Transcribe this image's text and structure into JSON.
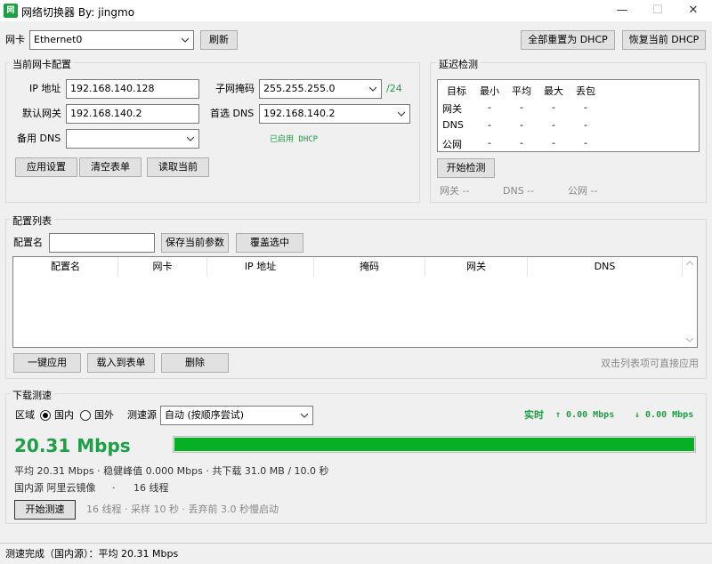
{
  "window": {
    "title": "网络切换器  By: jingmo",
    "minimize": "—",
    "maximize": "☐",
    "close": "✕",
    "app_icon_letter": "网"
  },
  "toolbar": {
    "nic_label": "网卡",
    "nic_value": "Ethernet0",
    "refresh": "刷新",
    "reset_all_dhcp": "全部重置为 DHCP",
    "restore_dhcp": "恢复当前 DHCP"
  },
  "nic_config": {
    "title": "当前网卡配置",
    "ip_label": "IP 地址",
    "ip_value": "192.168.140.128",
    "mask_label": "子网掩码",
    "mask_value": "255.255.255.0",
    "prefix": "/24",
    "gateway_label": "默认网关",
    "gateway_value": "192.168.140.2",
    "dns1_label": "首选 DNS",
    "dns1_value": "192.168.140.2",
    "dns2_label": "备用 DNS",
    "dns2_value": "",
    "dhcp_status": "已启用 DHCP",
    "apply": "应用设置",
    "clear": "清空表单",
    "read": "读取当前"
  },
  "latency": {
    "title": "延迟检测",
    "headers": [
      "目标",
      "最小",
      "平均",
      "最大",
      "丢包"
    ],
    "rows": [
      {
        "target": "网关",
        "min": "-",
        "avg": "-",
        "max": "-",
        "loss": "-"
      },
      {
        "target": "DNS",
        "min": "-",
        "avg": "-",
        "max": "-",
        "loss": "-"
      },
      {
        "target": "公网",
        "min": "-",
        "avg": "-",
        "max": "-",
        "loss": "-"
      }
    ],
    "start": "开始检测",
    "summary_gateway": "网关 --",
    "summary_dns": "DNS --",
    "summary_public": "公网 --"
  },
  "profiles": {
    "title": "配置列表",
    "name_label": "配置名",
    "name_value": "",
    "save": "保存当前参数",
    "overwrite": "覆盖选中",
    "columns": [
      "配置名",
      "网卡",
      "IP 地址",
      "掩码",
      "网关",
      "DNS"
    ],
    "apply_one": "一键应用",
    "load": "载入到表单",
    "delete": "删除",
    "hint": "双击列表项可直接应用"
  },
  "speedtest": {
    "title": "下载测速",
    "region_label": "区域",
    "region_domestic": "国内",
    "region_foreign": "国外",
    "source_label": "测速源",
    "source_value": "自动 (按顺序尝试)",
    "realtime_label": "实时",
    "up_rate": "↑ 0.00 Mbps",
    "down_rate": "↓ 0.00 Mbps",
    "big_speed": "20.31 Mbps",
    "progress": 1.0,
    "stats_line": "平均 20.31 Mbps  ·  稳健峰值 0.000 Mbps  ·  共下载 31.0 MB / 10.0 秒",
    "source_line_a": "国内源  阿里云镜像",
    "source_line_dot": "·",
    "source_line_b": "16 线程",
    "start": "开始测速",
    "params": "16 线程 · 采样 10 秒 · 丢弃前 3.0 秒慢启动"
  },
  "status": {
    "text": "测速完成（国内源）：平均 20.31 Mbps"
  },
  "colors": {
    "accent_green": "#1e9e45",
    "progress_green": "#06b025"
  }
}
